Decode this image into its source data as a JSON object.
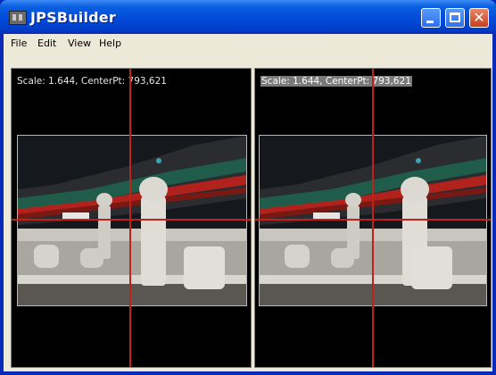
{
  "window": {
    "title": "JPSBuilder",
    "accent": "#0a2bb8"
  },
  "menu": [
    "File",
    "Edit",
    "View",
    "Help"
  ],
  "left_pane": {
    "info": "Scale: 1.644, CenterPt: 793,621"
  },
  "right_pane": {
    "info": "Scale: 1.644, CenterPt: 793,621"
  },
  "colors": {
    "guide_line": "#c2201a",
    "pane_background": "#000000"
  },
  "icons": {
    "app": "app-icon",
    "minimize": "minimize-icon",
    "maximize": "maximize-icon",
    "close": "close-icon"
  }
}
